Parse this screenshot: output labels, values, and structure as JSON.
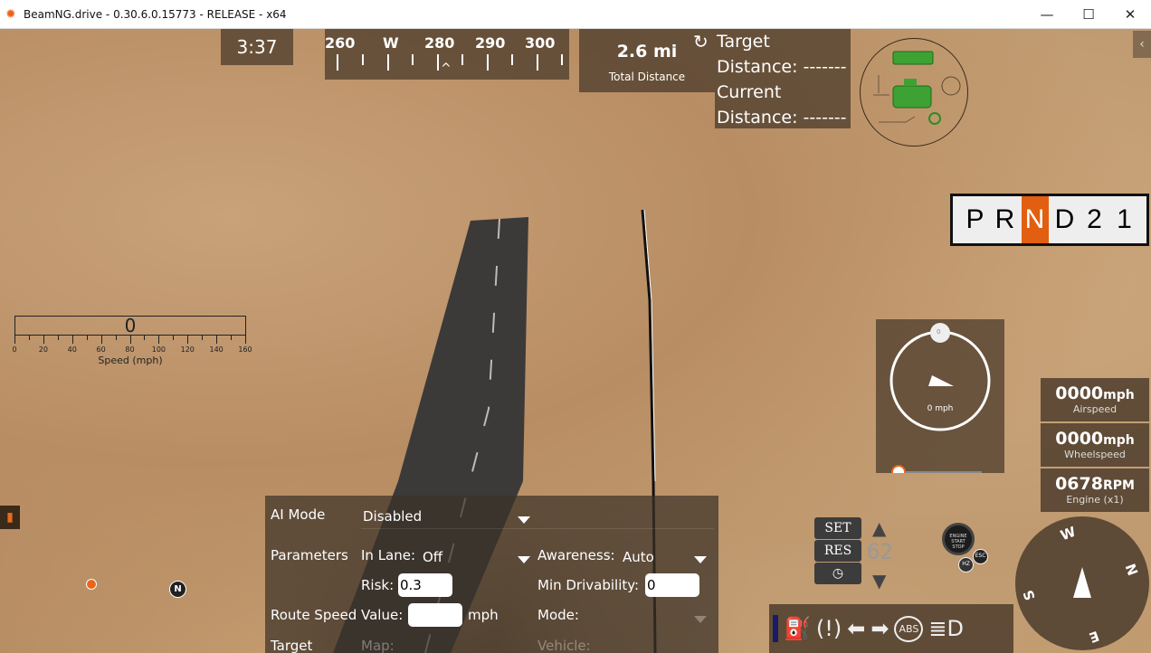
{
  "window": {
    "title": "BeamNG.drive - 0.30.6.0.15773 - RELEASE - x64",
    "minimize": "—",
    "maximize": "☐",
    "close": "✕"
  },
  "hud": {
    "clock": "3:37",
    "compass_strip": {
      "labels": [
        "260",
        "W",
        "280",
        "290",
        "300"
      ],
      "pointer": "^"
    },
    "total_distance": {
      "value": "2.6 mi",
      "label": "Total Distance"
    },
    "target": {
      "line1": "Target",
      "line2": "Distance: -------",
      "line3": "Current",
      "line4": "Distance: -------"
    },
    "gears": [
      "P",
      "R",
      "N",
      "D",
      "2",
      "1"
    ],
    "selected_gear": "N",
    "speed_bar": {
      "value": "0",
      "ticks": [
        "0",
        "20",
        "40",
        "60",
        "80",
        "100",
        "120",
        "140",
        "160"
      ],
      "caption": "Speed (mph)"
    },
    "gauge": {
      "top_value": "0",
      "speed": "0 mph"
    },
    "readouts": [
      {
        "value": "0000",
        "unit": "mph",
        "label": "Airspeed"
      },
      {
        "value": "0000",
        "unit": "mph",
        "label": "Wheelspeed"
      },
      {
        "value": "0678",
        "unit": "RPM",
        "label": "Engine (x1)"
      }
    ],
    "cruise": {
      "set": "SET",
      "res": "RES",
      "speed": "62"
    },
    "engine_button": {
      "line1": "ENGINE",
      "line2": "START",
      "line3": "STOP"
    },
    "esc": "ESC",
    "hz": "HZ",
    "abs": "ABS",
    "compass": {
      "W": "W",
      "N": "N",
      "S": "S",
      "E": "E"
    },
    "map_marker": "N"
  },
  "ai_panel": {
    "ai_mode_label": "AI Mode",
    "ai_mode_value": "Disabled",
    "parameters_label": "Parameters",
    "in_lane_label": "In Lane:",
    "in_lane_value": "Off",
    "awareness_label": "Awareness:",
    "awareness_value": "Auto",
    "risk_label": "Risk:",
    "risk_value": "0.3",
    "min_drivability_label": "Min Drivability:",
    "min_drivability_value": "0",
    "route_speed_label": "Route Speed",
    "value_label": "Value:",
    "route_speed_value": "",
    "unit": "mph",
    "mode_label": "Mode:",
    "target_label": "Target",
    "map_label": "Map:",
    "vehicle_label": "Vehicle:"
  },
  "colors": {
    "accent": "#e25e10",
    "engine_ok": "#2f9a2a"
  }
}
